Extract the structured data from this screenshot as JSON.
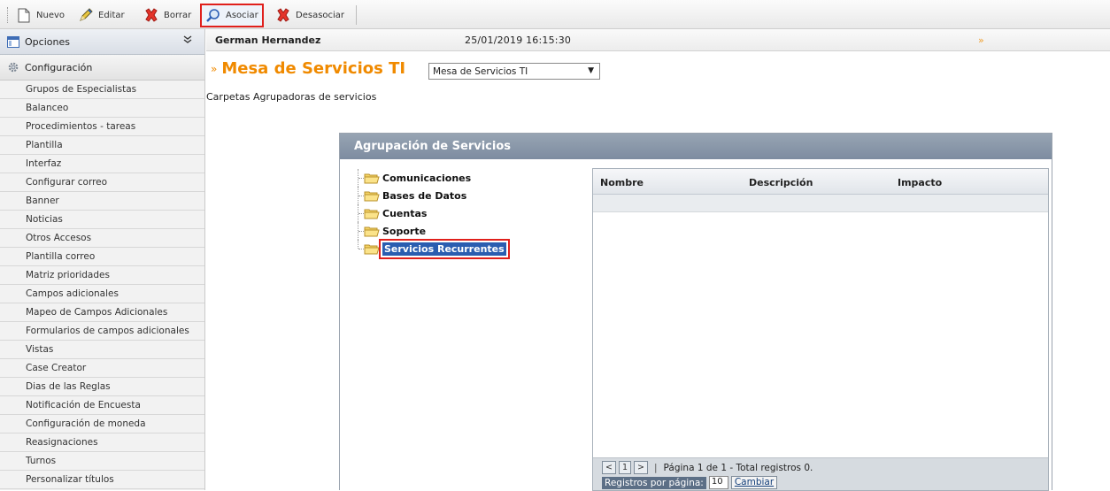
{
  "toolbar": {
    "nuevo": "Nuevo",
    "editar": "Editar",
    "borrar": "Borrar",
    "asociar": "Asociar",
    "desasociar": "Desasociar"
  },
  "sidebar": {
    "opciones": "Opciones",
    "chevron": "»",
    "configuracion": "Configuración",
    "items": [
      "Grupos de Especialistas",
      "Balanceo",
      "Procedimientos - tareas",
      "Plantilla",
      "Interfaz",
      "Configurar correo",
      "Banner",
      "Noticias",
      "Otros Accesos",
      "Plantilla correo",
      "Matriz prioridades",
      "Campos adicionales",
      "Mapeo de Campos Adicionales",
      "Formularios de campos adicionales",
      "Vistas",
      "Case Creator",
      "Dias de las Reglas",
      "Notificación de Encuesta",
      "Configuración de moneda",
      "Reasignaciones",
      "Turnos",
      "Personalizar títulos"
    ]
  },
  "infobar": {
    "user": "German Hernandez",
    "datetime": "25/01/2019 16:15:30",
    "arrow": "»"
  },
  "page": {
    "title_mark": "»",
    "title": "Mesa de Servicios TI",
    "select_value": "Mesa de Servicios TI",
    "subtitle": "Carpetas Agrupadoras de servicios"
  },
  "panel": {
    "title": "Agrupación de Servicios",
    "tree": [
      "Comunicaciones",
      "Bases de Datos",
      "Cuentas",
      "Soporte",
      "Servicios Recurrentes"
    ],
    "columns": [
      "Nombre",
      "Descripción",
      "Impacto"
    ],
    "pager": {
      "prev": "<",
      "page": "1",
      "next": ">",
      "sep": "|",
      "info": "Página 1 de 1 - Total registros 0.",
      "rpp_label": "Registros por página:",
      "rpp_value": "10",
      "change": "Cambiar"
    }
  }
}
